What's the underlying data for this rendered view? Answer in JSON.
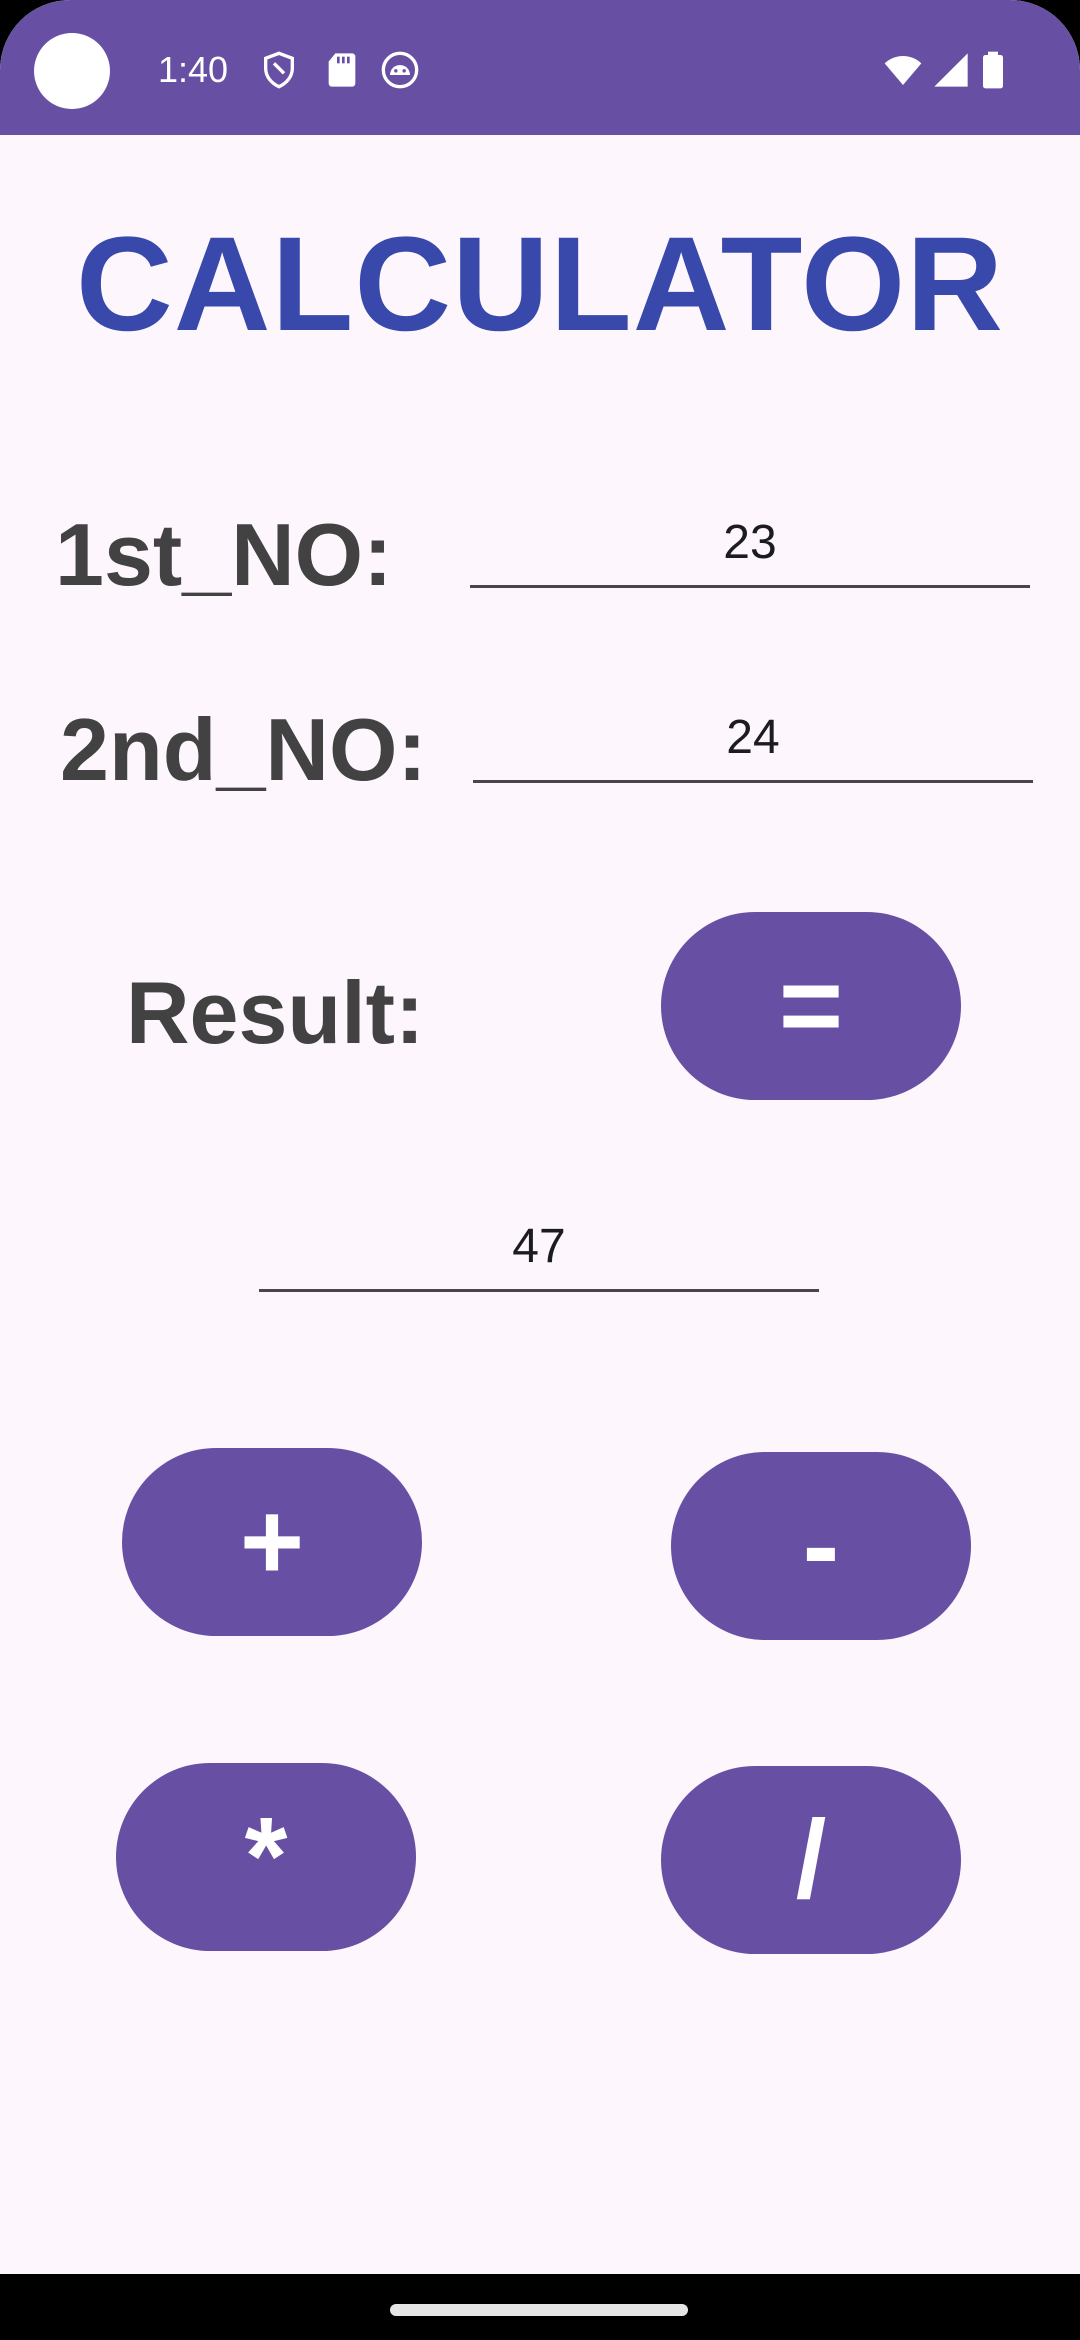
{
  "status_bar": {
    "time": "1:40",
    "icons": [
      "shield-icon",
      "sd-card-icon",
      "android-face-icon",
      "wifi-icon",
      "cellular-signal-icon",
      "battery-icon"
    ],
    "color": "#6750a4"
  },
  "app": {
    "title": "CALCULATOR",
    "title_color": "#3949ab"
  },
  "form": {
    "first_label": "1st_NO:",
    "first_value": "23",
    "second_label": "2nd_NO:",
    "second_value": "24",
    "result_label": "Result:",
    "result_value": "47"
  },
  "buttons": {
    "equals": "=",
    "add": "+",
    "subtract": "-",
    "multiply": "*",
    "divide": "/",
    "color": "#6750a4"
  }
}
